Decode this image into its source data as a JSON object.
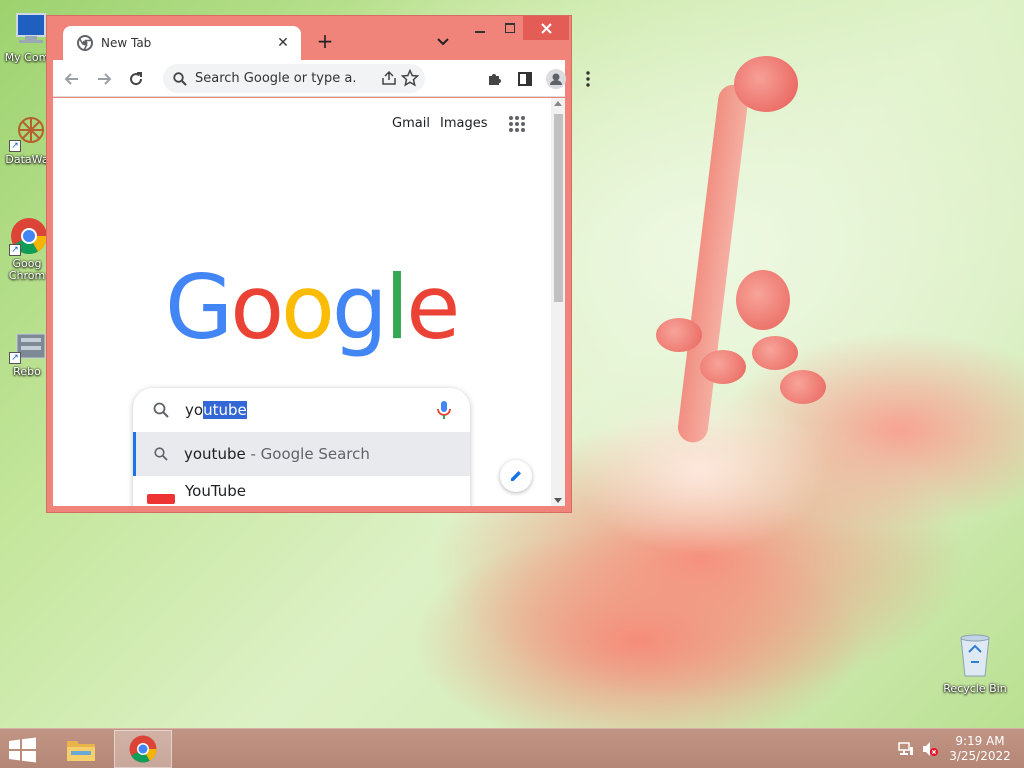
{
  "desktop": {
    "icons": [
      {
        "label": "My Com",
        "icon": "computer-icon"
      },
      {
        "label": "DataWa",
        "icon": "datawarrior-icon"
      },
      {
        "label": "Goog Chrom",
        "icon": "chrome-icon"
      },
      {
        "label": "Rebo",
        "icon": "reboot-icon"
      }
    ],
    "recycle_bin": {
      "label": "Recycle Bin",
      "icon": "recycle-bin-icon"
    }
  },
  "browser": {
    "tab": {
      "title": "New Tab"
    },
    "omnibox": {
      "placeholder": "Search Google or type a..."
    },
    "page": {
      "top_links": {
        "gmail": "Gmail",
        "images": "Images"
      },
      "logo": [
        "G",
        "o",
        "o",
        "g",
        "l",
        "e"
      ],
      "logo_colors": [
        "#4285F4",
        "#EA4335",
        "#FBBC05",
        "#4285F4",
        "#34A853",
        "#EA4335"
      ],
      "search": {
        "typed": "yo",
        "selected": "utube",
        "suggestions": [
          {
            "bold": "youtube",
            "rest": " - Google Search"
          },
          {
            "title": "YouTube"
          }
        ]
      }
    }
  },
  "taskbar": {
    "clock": {
      "time": "9:19 AM",
      "date": "3/25/2022"
    }
  }
}
